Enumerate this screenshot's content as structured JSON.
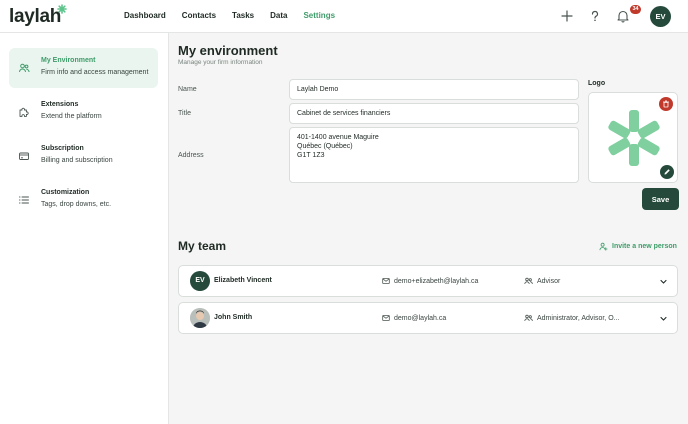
{
  "brand": {
    "name": "laylah",
    "accent": "#3f9c6a",
    "dark": "#254a3b"
  },
  "nav": [
    {
      "label": "Dashboard",
      "active": false
    },
    {
      "label": "Contacts",
      "active": false
    },
    {
      "label": "Tasks",
      "active": false
    },
    {
      "label": "Data",
      "active": false
    },
    {
      "label": "Settings",
      "active": true
    }
  ],
  "topbar": {
    "icons": [
      "plus-icon",
      "help-icon",
      "bell-icon"
    ],
    "notification_count": "34",
    "avatar_initials": "EV"
  },
  "sidebar": {
    "items": [
      {
        "title": "My Environment",
        "subtitle": "Firm info and access management",
        "icon": "people-icon",
        "active": true
      },
      {
        "title": "Extensions",
        "subtitle": "Extend the platform",
        "icon": "puzzle-icon",
        "active": false
      },
      {
        "title": "Subscription",
        "subtitle": "Billing and subscription",
        "icon": "card-icon",
        "active": false
      },
      {
        "title": "Customization",
        "subtitle": "Tags, drop downs, etc.",
        "icon": "list-icon",
        "active": false
      }
    ]
  },
  "environment": {
    "title": "My environment",
    "subtitle": "Manage your firm information",
    "name_label": "Name",
    "name_value": "Laylah Demo",
    "title_label": "Title",
    "title_value": "Cabinet de services financiers",
    "address_label": "Address",
    "address_lines": [
      "401-1400 avenue Maguire",
      "Québec (Québec)",
      "G1T 1Z3"
    ],
    "logo_label": "Logo",
    "save_label": "Save"
  },
  "team": {
    "title": "My team",
    "invite_label": "Invite a new person",
    "members": [
      {
        "initials": "EV",
        "name": "Elizabeth Vincent",
        "email": "demo+elizabeth@laylah.ca",
        "role": "Advisor"
      },
      {
        "initials": "",
        "name": "John Smith",
        "email": "demo@laylah.ca",
        "role": "Administrator, Advisor, O..."
      }
    ]
  }
}
